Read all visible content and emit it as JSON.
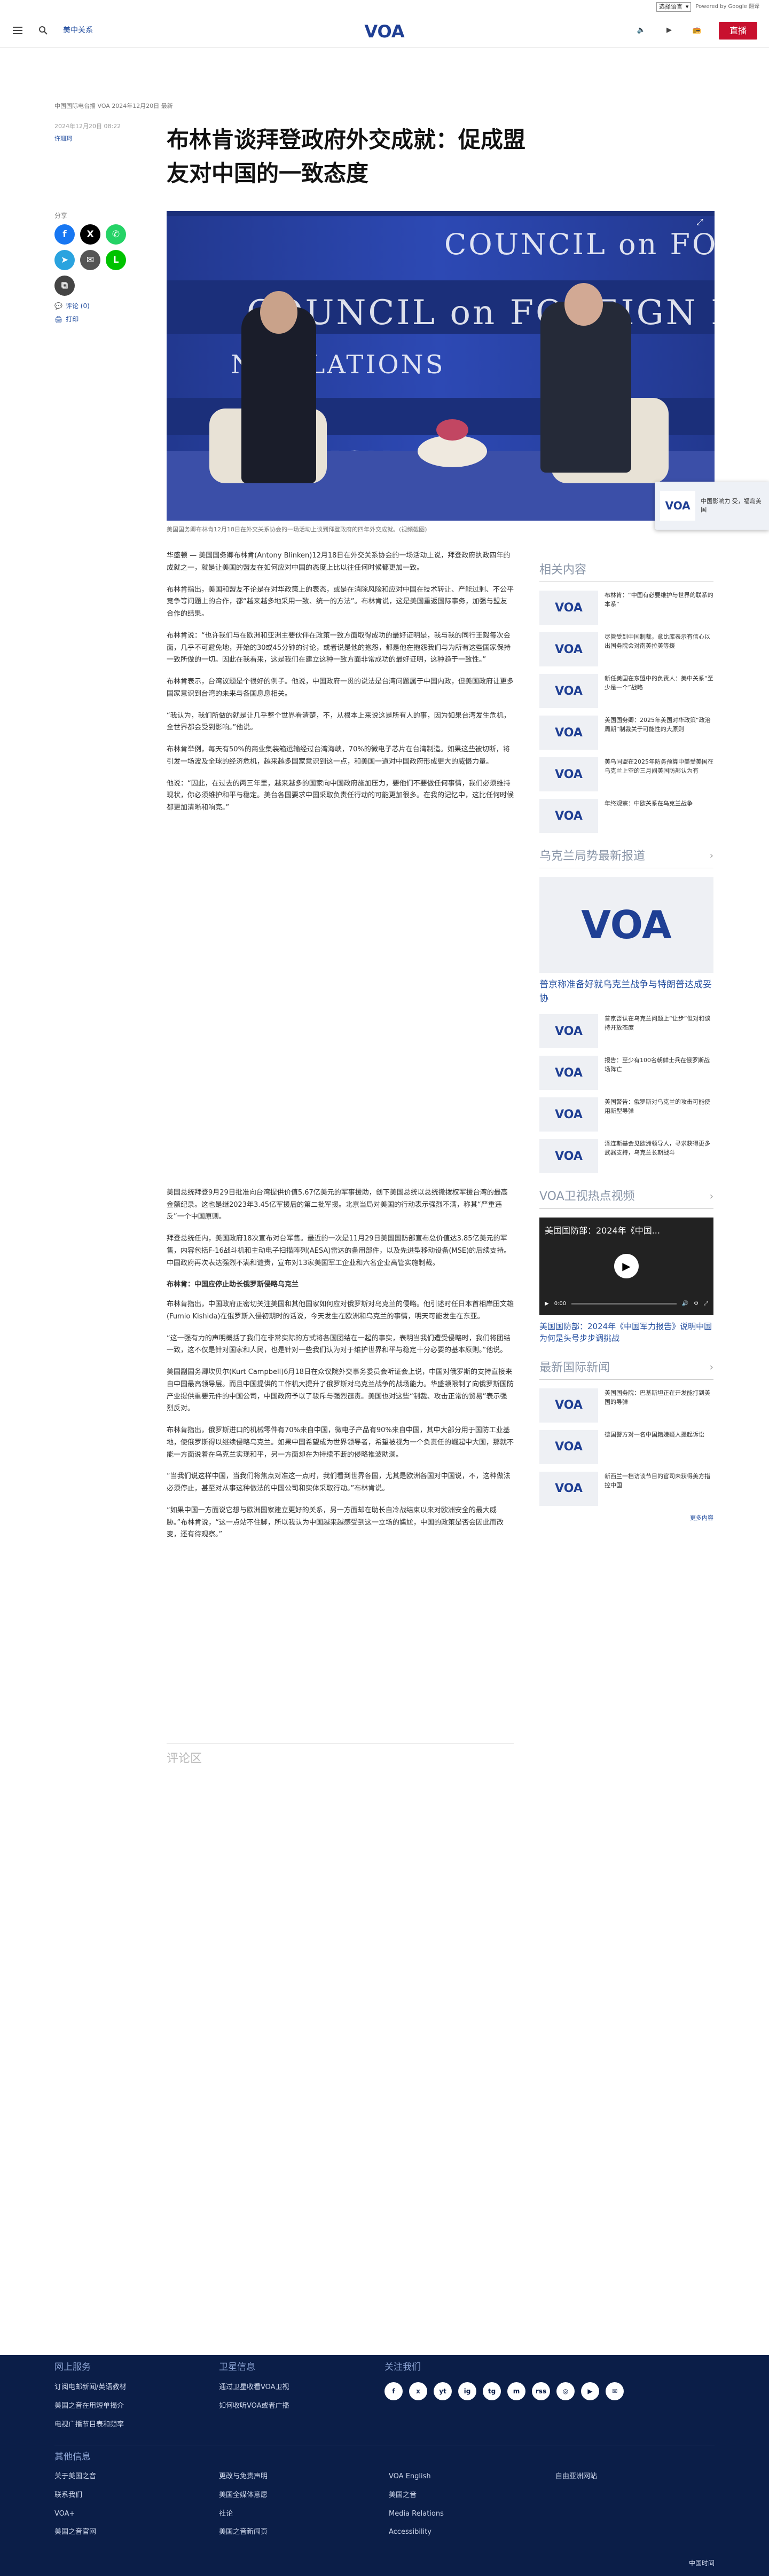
{
  "utility": {
    "lang_label": "选择语言",
    "powered": "Powered by Google 翻译"
  },
  "header": {
    "section": "美中关系",
    "logo": "VOA",
    "live": "直播"
  },
  "meta": {
    "line1": "中国国际电台播 VOA 2024年12月20日 最新",
    "date": "2024年12月20日 08:22",
    "author": "许珊珂"
  },
  "article": {
    "title": "布林肯谈拜登政府外交成就：促成盟友对中国的一致态度",
    "caption": "美国国务卿布林肯12月18日在外交关系协会的一场活动上谈到拜登政府的四年外交成就。(视频截图)",
    "p1": "华盛顿 — 美国国务卿布林肯(Antony Blinken)12月18日在外交关系协会的一场活动上说，拜登政府执政四年的成就之一，就是让美国的盟友在如何应对中国的态度上比以往任何时候都更加一致。",
    "p2": "布林肯指出，美国和盟友不论是在对华政策上的表态，或是在消除风险和应对中国在技术转让、产能过剩、不公平竞争等问题上的合作，都“越来越多地采用一致、统一的方法”。布林肯说，这是美国重返国际事务，加强与盟友合作的结果。",
    "p3": "布林肯说：“也许我们与在欧洲和亚洲主要伙伴在政策一致方面取得成功的最好证明是，我与我的同行王毅每次会面，几乎不可避免地，开始的30或45分钟的讨论，或者说是他的抱怨，都是他在抱怨我们与为所有这些国家保持一致所做的一切。因此在我看来，这是我们在建立这种一致方面非常成功的最好证明，这种趋于一致性。”",
    "p4": "布林肯表示，台湾议题是个很好的例子。他说，中国政府一贯的说法是台湾问题属于中国内政，但美国政府让更多国家意识到台湾的未来与各国息息相关。",
    "p5": "“我认为，我们所做的就是让几乎整个世界看清楚，不，从根本上来说这是所有人的事，因为如果台湾发生危机，全世界都会受到影响。”他说。",
    "p6": "布林肯举例，每天有50%的商业集装箱运输经过台湾海峡，70%的微电子芯片在台湾制造。如果这些被切断，将引发一场波及全球的经济危机，越来越多国家意识到这一点，和美国一道对中国政府形成更大的威慑力量。",
    "p7": "他说：“因此，在过去的两三年里，越来越多的国家向中国政府施加压力，要他们不要做任何事情，我们必须维持现状，你必须维护和平与稳定。美台各国要求中国采取负责任行动的可能更加很多。在我的记忆中，这比任何时候都更加清晰和响亮。”",
    "p8": "美国总统拜登9月29日批准向台湾提供价值5.67亿美元的军事援助，创下美国总统以总统撤拨权军援台湾的最高金额纪录。这也是继2023年3.45亿军援后的第二批军援。北京当局对美国的行动表示强烈不满，称其“严重违反”一个中国原则。",
    "p9": "拜登总统任内，美国政府18次宣布对台军售。最近的一次是11月29日美国国防部宣布总价值达3.85亿美元的军售，内容包括F-16战斗机和主动电子扫描阵列(AESA)雷达的备用部件，以及先进型移动设备(MSE)的后续支持。中国政府再次表达强烈不满和谴责，宣布对13家美国军工企业和六名企业高管实施制裁。",
    "h1": "布林肯：中国应停止助长俄罗斯侵略乌克兰",
    "p10": "布林肯指出，中国政府正密切关注美国和其他国家如何应对俄罗斯对乌克兰的侵略。他引述时任日本首相岸田文雄(Fumio Kishida)在俄罗斯入侵初期时的话说，今天发生在欧洲和乌克兰的事情，明天可能发生在东亚。",
    "p11": "“这一强有力的声明概括了我们在非常实际的方式将各国团结在一起的事实，表明当我们遭受侵略时，我们将团结一致，这不仅是针对国家和人民，也是针对一些我们认为对于维护世界和平与稳定十分必要的基本原则。”他说。",
    "p12": "美国副国务卿坎贝尔(Kurt Campbell)6月18日在众议院外交事务委员会听证会上说，中国对俄罗斯的支持直接来自中国最高领导层。而且中国提供的工作机大提升了俄罗斯对乌克兰战争的战场能力。华盛顿限制了向俄罗斯国防产业提供重要元件的中国公司，中国政府予以了驳斥与强烈谴责。美国也对这些“制裁、攻击正常的贸易”表示强烈反对。",
    "p13": "布林肯指出，俄罗斯进口的机械零件有70%来自中国，微电子产品有90%来自中国，其中大部分用于国防工业基地，使俄罗斯得以继续侵略乌克兰。如果中国希望成为世界领导者，希望被视为一个负责任的崛起中大国，那就不能一方面说着在乌克兰实现和平，另一方面却在为持续不断的侵略推波助澜。",
    "p14": "“当我们说这样中国，当我们将焦点对准这一点时，我们看到世界各国，尤其是欧洲各国对中国说，不，这种做法必须停止，甚至对从事这种做法的中国公司和实体采取行动。”布林肯说。",
    "p15": "“如果中国一方面说它想与欧洲国家建立更好的关系，另一方面却在助长自冷战结束以来对欧洲安全的最大威胁。”布林肯说，“这一点站不住脚，所以我认为中国越来越感受到这一立场的尴尬，中国的政策是否会因此而改变，还有待观察。”",
    "comments": "评论区",
    "float_text": "中国影响力\n受，福岛美国"
  },
  "share": {
    "label": "分享",
    "comments": "评论 (0)",
    "print": "打印"
  },
  "sidebar": {
    "related_h": "相关内容",
    "related": [
      {
        "text": "布林肯：“中国有必要维护与世界的联系的本系”"
      },
      {
        "text": "尽管受到中国制裁，意比库表示有信心以出国务院会对南美拉美等援"
      },
      {
        "text": "新任美国在东盟中的负责人：美中关系“至少是一个”战略"
      },
      {
        "text": "美国国务卿：2025年美国对华政策“政治周期”制裁关于可能性的大原则"
      },
      {
        "text": "美乌同盟在2025年防务预算中美受美国在乌克兰上空的三月间美国防部认为有"
      },
      {
        "text": "年终观察：中欧关系在乌克兰战争"
      }
    ],
    "ukraine_h": "乌克兰局势最新报道",
    "ukraine_big": "普京称准备好就乌克兰战争与特朗普达成妥协",
    "ukraine": [
      {
        "text": "普京否认在乌克兰问题上“让步”但对和谈持开放态度"
      },
      {
        "text": "报告：至少有100名朝鲜士兵在俄罗斯战场阵亡"
      },
      {
        "text": "美国警告：俄罗斯对乌克兰的攻击可能使用新型导弹"
      },
      {
        "text": "泽连斯基会见欧洲领导人，寻求获得更多武器支持，乌克兰长期战斗"
      }
    ],
    "video_h": "VOA卫视热点视频",
    "video_title": "美国国防部：2024年《中国...",
    "video_time": "0:00",
    "video_caption": "美国国防部：2024年《中国军力报告》说明中国为何是头号步步调挑战",
    "latest_h": "最新国际新闻",
    "latest": [
      {
        "text": "美国国务院：巴基斯坦正在开发能打到美国的导弹"
      },
      {
        "text": "德国警方对一名中国籍嫌疑人提起诉讼"
      },
      {
        "text": "新西兰一档访谈节目的官司未获得美方指控中国"
      }
    ],
    "more": "更多内容"
  },
  "footer": {
    "col1_h": "网上服务",
    "col1": [
      "订阅电邮新闻/英语教材",
      "美国之音在用短单揭介",
      "电视广播节目表和频率"
    ],
    "col2_h": "卫星信息",
    "col2": [
      "通过卫星收看VOA卫视",
      "如何收听VOA或者广播"
    ],
    "col3_h": "关注我们",
    "social": [
      "f",
      "x",
      "yt",
      "ig",
      "tg",
      "m",
      "rss",
      "◎",
      "▶",
      "✉"
    ],
    "other_h": "其他信息",
    "links_a": [
      "关于美国之音",
      "联系我们",
      "VOA+",
      "美国之音官网"
    ],
    "links_b": [
      "更改与免责声明",
      "美国全媒体意愿",
      "社论",
      "美国之音新闻页"
    ],
    "links_c": [
      "VOA English",
      "美国之音",
      "Media Relations",
      "Accessibility"
    ],
    "links_d": [
      "自由亚洲网站"
    ],
    "copyright": "中国时间"
  }
}
